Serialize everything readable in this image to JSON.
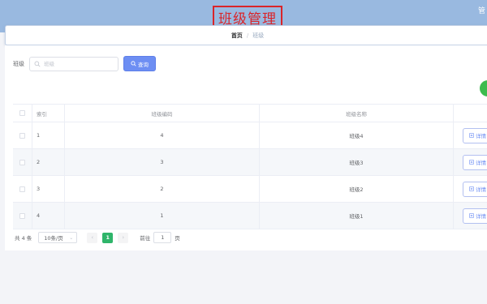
{
  "page_title": "班级管理",
  "top_right_text": "管",
  "breadcrumb": {
    "home": "首页",
    "separator": "/",
    "current": "班级"
  },
  "search": {
    "label": "班级",
    "placeholder": "班级",
    "value": "",
    "button_label": "查询"
  },
  "table": {
    "headers": {
      "index": "索引",
      "code": "班级编码",
      "name": "班级名称"
    },
    "rows": [
      {
        "index": "1",
        "code": "4",
        "name": "班级4",
        "detail": "详情"
      },
      {
        "index": "2",
        "code": "3",
        "name": "班级3",
        "detail": "详情"
      },
      {
        "index": "3",
        "code": "2",
        "name": "班级2",
        "detail": "详情"
      },
      {
        "index": "4",
        "code": "1",
        "name": "班级1",
        "detail": "详情"
      }
    ]
  },
  "pagination": {
    "total": "共 4 条",
    "page_size": "10条/页",
    "current_page": "1",
    "goto_label": "前往",
    "goto_value": "1",
    "goto_suffix": "页"
  },
  "colors": {
    "topbar": "#99b9e0",
    "primary": "#6d8ef3",
    "active_page": "#2fb56a",
    "title_highlight": "#d9252a",
    "add_button": "#3dbb4e"
  }
}
